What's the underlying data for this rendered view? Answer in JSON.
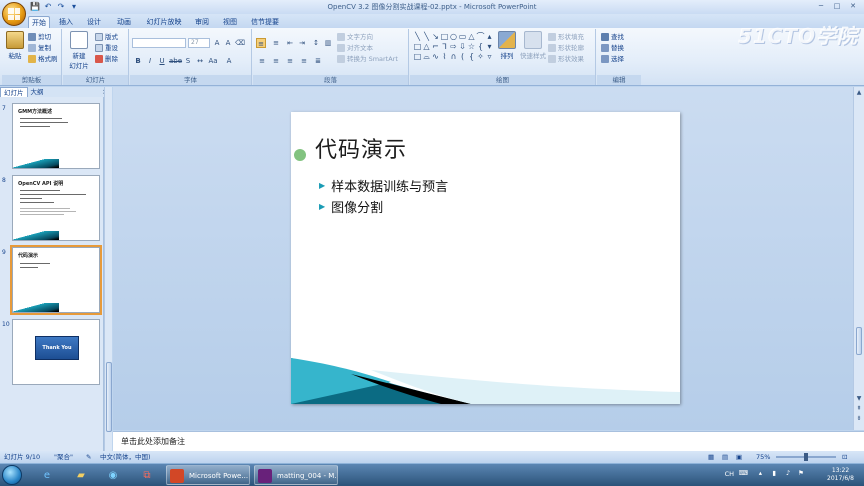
{
  "window": {
    "title": "OpenCV 3.2 图像分割实战课程-02.pptx - Microsoft PowerPoint",
    "watermark": "51CTO学院",
    "minimize": "─",
    "maximize": "□",
    "close": "✕"
  },
  "qat": {
    "save": "💾",
    "undo": "↶",
    "redo": "↷",
    "more": "▾"
  },
  "tabs": [
    "开始",
    "插入",
    "设计",
    "动画",
    "幻灯片放映",
    "审阅",
    "视图",
    "信节提要"
  ],
  "ribbon": {
    "clipboard": {
      "label": "剪贴板",
      "paste": "粘贴",
      "cut": "剪切",
      "copy": "复制",
      "format_painter": "格式刷"
    },
    "slides": {
      "label": "幻灯片",
      "new_slide": "新建",
      "new_slide2": "幻灯片",
      "layout": "版式",
      "reset": "重设",
      "delete": "删除"
    },
    "font": {
      "label": "字体",
      "font_placeholder": "",
      "size": "27"
    },
    "paragraph": {
      "label": "段落",
      "text_direction": "文字方向",
      "align_text": "对齐文本",
      "smartart": "转换为 SmartArt"
    },
    "drawing": {
      "label": "绘图",
      "arrange": "排列",
      "quick_styles": "快速样式",
      "shape_fill": "形状填充",
      "shape_outline": "形状轮廓",
      "shape_effects": "形状效果"
    },
    "editing": {
      "label": "编辑",
      "find": "查找",
      "replace": "替换",
      "select": "选择"
    }
  },
  "pane": {
    "tab_slides": "幻灯片",
    "tab_outline": "大纲",
    "close": "×"
  },
  "thumbnails": [
    {
      "num": "7",
      "title": "GMM方法概述"
    },
    {
      "num": "8",
      "title": "OpenCV API 说明"
    },
    {
      "num": "9",
      "title": "代码演示"
    },
    {
      "num": "10",
      "title": "Thank You"
    }
  ],
  "slide": {
    "title": "代码演示",
    "bullets": [
      "样本数据训练与预言",
      "图像分割"
    ]
  },
  "notes": "单击此处添加备注",
  "status": {
    "slide_index": "幻灯片 9/10",
    "theme": "\"聚合\"",
    "language": "中文(简体，中国)",
    "zoom": "75%"
  },
  "taskbar": {
    "ppt_label": "Microsoft Powe...",
    "vs_label": "matting_004 - M...",
    "ime": "CH",
    "time": "13:22",
    "date": "2017/6/8"
  },
  "colors": {
    "accent": "#1a9cb5",
    "ribbon_text": "#15428b",
    "selection": "#e79a3a"
  }
}
